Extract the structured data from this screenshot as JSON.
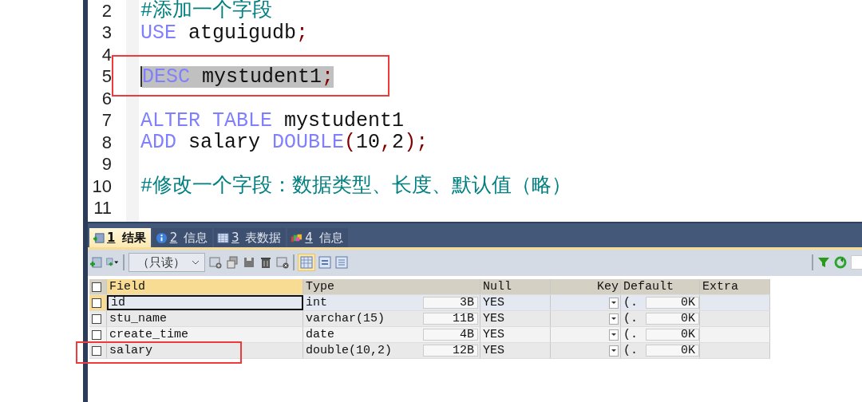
{
  "editor": {
    "lines": [
      {
        "number": "2",
        "selected": false,
        "annotated": false,
        "tokens": [
          {
            "kind": "comment",
            "text": "#添加一个字段"
          }
        ]
      },
      {
        "number": "3",
        "selected": false,
        "annotated": false,
        "tokens": [
          {
            "kind": "keyword",
            "text": "USE"
          },
          {
            "kind": "plain",
            "text": " atguigudb"
          },
          {
            "kind": "punct",
            "text": ";"
          }
        ]
      },
      {
        "number": "4",
        "selected": false,
        "annotated": false
      },
      {
        "number": "5",
        "selected": true,
        "annotated": true,
        "tokens": [
          {
            "kind": "keyword",
            "text": "DESC"
          },
          {
            "kind": "plain",
            "text": " mystudent1"
          },
          {
            "kind": "punct",
            "text": ";"
          }
        ]
      },
      {
        "number": "6",
        "selected": false,
        "annotated": false
      },
      {
        "number": "7",
        "selected": false,
        "annotated": false,
        "tokens": [
          {
            "kind": "keyword",
            "text": "ALTER TABLE"
          },
          {
            "kind": "plain",
            "text": " mystudent1"
          }
        ]
      },
      {
        "number": "8",
        "selected": false,
        "annotated": false,
        "tokens": [
          {
            "kind": "keyword",
            "text": "ADD"
          },
          {
            "kind": "plain",
            "text": " salary "
          },
          {
            "kind": "keyword",
            "text": "DOUBLE"
          },
          {
            "kind": "punct",
            "text": "("
          },
          {
            "kind": "plain",
            "text": "10"
          },
          {
            "kind": "punct",
            "text": ","
          },
          {
            "kind": "plain",
            "text": "2"
          },
          {
            "kind": "punct",
            "text": ");"
          }
        ]
      },
      {
        "number": "9",
        "selected": false,
        "annotated": false
      },
      {
        "number": "10",
        "selected": false,
        "annotated": false,
        "tokens": [
          {
            "kind": "comment",
            "text": "#修改一个字段：数据类型、长度、默认值（略）"
          }
        ]
      },
      {
        "number": "11",
        "selected": false,
        "annotated": false
      }
    ]
  },
  "result_tabs": [
    {
      "kind": "result",
      "number": "1",
      "label": "结果",
      "selected": true
    },
    {
      "kind": "info",
      "number": "2",
      "label": "信息",
      "selected": false
    },
    {
      "kind": "table",
      "number": "3",
      "label": "表数据",
      "selected": false
    },
    {
      "kind": "profile",
      "number": "4",
      "label": "信息",
      "selected": false
    }
  ],
  "toolbar": {
    "mode_select": {
      "value": "（只读）"
    }
  },
  "grid": {
    "select_all_checked": false,
    "columns": [
      "Field",
      "Type",
      "Null",
      "Key",
      "Default",
      "Extra"
    ],
    "rows": [
      {
        "checked": false,
        "selected": true,
        "annotated": false,
        "field": "id",
        "type": "int",
        "size": "3B",
        "null": "YES",
        "default": "(.",
        "default_size": "0K"
      },
      {
        "checked": false,
        "selected": false,
        "annotated": false,
        "field": "stu_name",
        "type": "varchar(15)",
        "size": "11B",
        "null": "YES",
        "default": "(.",
        "default_size": "0K"
      },
      {
        "checked": false,
        "selected": false,
        "annotated": false,
        "field": "create_time",
        "type": "date",
        "size": "4B",
        "null": "YES",
        "default": "(.",
        "default_size": "0K"
      },
      {
        "checked": false,
        "selected": false,
        "annotated": true,
        "field": "salary",
        "type": "double(10,2)",
        "size": "12B",
        "null": "YES",
        "default": "(.",
        "default_size": "0K"
      }
    ]
  }
}
